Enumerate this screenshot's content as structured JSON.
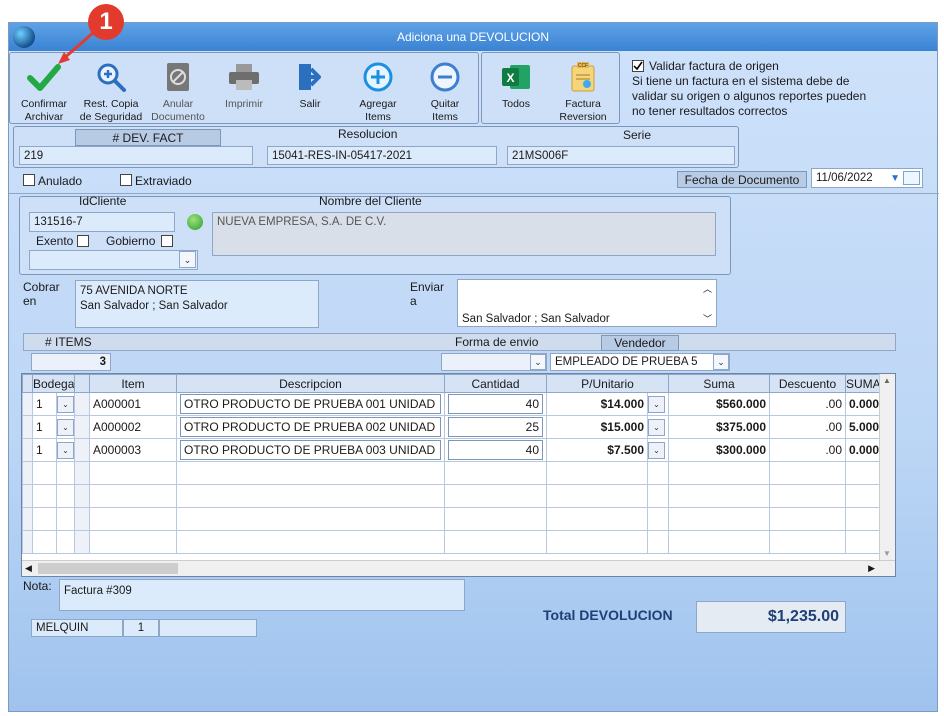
{
  "window": {
    "title": "Adiciona una DEVOLUCION"
  },
  "annotation": {
    "number": "1"
  },
  "toolbar": {
    "confirm": "Confirmar\nArchivar",
    "restore": "Rest. Copia\nde Seguridad",
    "void": "Anular\nDocumento",
    "print": "Imprimir",
    "exit": "Salir",
    "add_items": "Agregar\nItems",
    "remove_items": "Quitar\nItems",
    "all": "Todos",
    "invoice_reversal": "Factura\nReversion"
  },
  "validate": {
    "label": "Validar factura de origen",
    "checked": true,
    "note": "Si tiene un factura en el sistema debe de validar su origen o algunos reportes pueden no tener resultados correctos"
  },
  "doc": {
    "dev_fact_label": "# DEV. FACT",
    "dev_fact": "219",
    "resolution_label": "Resolucion",
    "resolution": "15041-RES-IN-05417-2021",
    "serie_label": "Serie",
    "serie": "21MS006F",
    "anulado_label": "Anulado",
    "extraviado_label": "Extraviado",
    "fecha_label": "Fecha de  Documento",
    "fecha": "11/06/2022"
  },
  "client": {
    "id_label": "IdCliente",
    "id": "131516-7",
    "name_label": "Nombre del Cliente",
    "name": "NUEVA EMPRESA, S.A. DE C.V.",
    "exento_label": "Exento",
    "gobierno_label": "Gobierno",
    "cobrar_label": "Cobrar\nen",
    "cobrar": "75 AVENIDA NORTE\nSan Salvador ; San Salvador",
    "enviar_label": "Enviar\na",
    "enviar": "\nSan Salvador ; San Salvador\nSan Salvador ; San Salvador"
  },
  "summary": {
    "items_label": "# ITEMS",
    "items": "3",
    "forma_label": "Forma de envio",
    "forma": "",
    "vendedor_label": "Vendedor",
    "vendedor": "EMPLEADO DE PRUEBA 5"
  },
  "grid": {
    "columns": [
      "Bodega",
      "Item",
      "Descripcion",
      "Cantidad",
      "P/Unitario",
      "Suma",
      "Descuento",
      "SUMA"
    ],
    "rows": [
      {
        "bodega": "1",
        "item": "A000001",
        "desc": "OTRO PRODUCTO DE PRUEBA 001 UNIDAD",
        "cantidad": "40",
        "precio": "$14.000",
        "suma": "$560.000",
        "descuento": ".00",
        "suma2": "0.000"
      },
      {
        "bodega": "1",
        "item": "A000002",
        "desc": "OTRO PRODUCTO DE PRUEBA 002 UNIDAD",
        "cantidad": "25",
        "precio": "$15.000",
        "suma": "$375.000",
        "descuento": ".00",
        "suma2": "5.000"
      },
      {
        "bodega": "1",
        "item": "A000003",
        "desc": "OTRO PRODUCTO DE PRUEBA 003 UNIDAD",
        "cantidad": "40",
        "precio": "$7.500",
        "suma": "$300.000",
        "descuento": ".00",
        "suma2": "0.000"
      }
    ]
  },
  "nota": {
    "label": "Nota:",
    "value": "Factura #309"
  },
  "status": {
    "user": "MELQUIN",
    "num": "1",
    "extra": ""
  },
  "total": {
    "label": "Total DEVOLUCION",
    "value": "$1,235.00"
  },
  "colors": {
    "accent": "#3a82d3",
    "confirm_green": "#22a845",
    "annotation_red": "#e23b2e"
  }
}
